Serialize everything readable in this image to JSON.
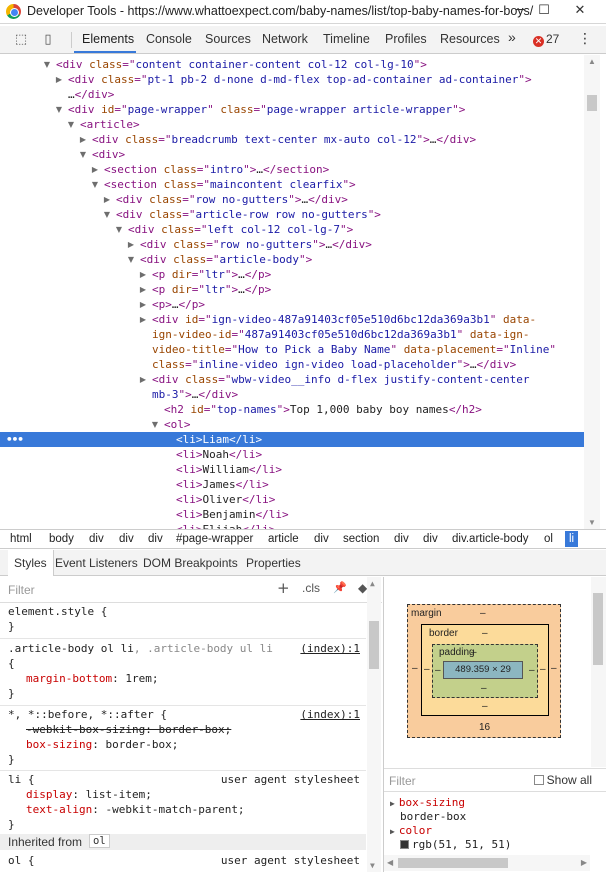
{
  "window": {
    "title": "Developer Tools - https://www.whattoexpect.com/baby-names/list/top-baby-names-for-boys/",
    "minimize_glyph": "─",
    "maximize_glyph": "☐",
    "close_glyph": "✕"
  },
  "toolbar": {
    "inspect_icon": "⬚",
    "device_icon": "▯",
    "tabs": [
      "Elements",
      "Console",
      "Sources",
      "Network",
      "Timeline",
      "Profiles",
      "Resources"
    ],
    "more_glyph": "»",
    "error_count": "27",
    "error_glyph": "✕",
    "menu_glyph": "⋮"
  },
  "dom_rows": [
    {
      "arrow": "▼",
      "indent": 56,
      "parts": [
        [
          "tag",
          "<div "
        ],
        [
          "attr",
          "class"
        ],
        [
          "tag",
          "=\""
        ],
        [
          "val",
          "content container-content col-12 col-lg-10"
        ],
        [
          "tag",
          "\">"
        ]
      ]
    },
    {
      "arrow": "▶",
      "indent": 68,
      "parts": [
        [
          "tag",
          "<div "
        ],
        [
          "attr",
          "class"
        ],
        [
          "tag",
          "=\""
        ],
        [
          "val",
          "pt-1 pb-2 d-none d-md-flex top-ad-container ad-container"
        ],
        [
          "tag",
          "\">"
        ]
      ]
    },
    {
      "arrow": "",
      "indent": 68,
      "parts": [
        [
          "txt",
          "…"
        ],
        [
          "tag",
          "</div>"
        ]
      ]
    },
    {
      "arrow": "▼",
      "indent": 68,
      "parts": [
        [
          "tag",
          "<div "
        ],
        [
          "attr",
          "id"
        ],
        [
          "tag",
          "=\""
        ],
        [
          "val",
          "page-wrapper"
        ],
        [
          "tag",
          "\" "
        ],
        [
          "attr",
          "class"
        ],
        [
          "tag",
          "=\""
        ],
        [
          "val",
          "page-wrapper article-wrapper"
        ],
        [
          "tag",
          "\">"
        ]
      ]
    },
    {
      "arrow": "▼",
      "indent": 80,
      "parts": [
        [
          "tag",
          "<article>"
        ]
      ]
    },
    {
      "arrow": "▶",
      "indent": 92,
      "parts": [
        [
          "tag",
          "<div "
        ],
        [
          "attr",
          "class"
        ],
        [
          "tag",
          "=\""
        ],
        [
          "val",
          "breadcrumb text-center mx-auto col-12"
        ],
        [
          "tag",
          "\">"
        ],
        [
          "txt",
          "…"
        ],
        [
          "tag",
          "</div>"
        ]
      ]
    },
    {
      "arrow": "▼",
      "indent": 92,
      "parts": [
        [
          "tag",
          "<div>"
        ]
      ]
    },
    {
      "arrow": "▶",
      "indent": 104,
      "parts": [
        [
          "tag",
          "<section "
        ],
        [
          "attr",
          "class"
        ],
        [
          "tag",
          "=\""
        ],
        [
          "val",
          "intro"
        ],
        [
          "tag",
          "\">"
        ],
        [
          "txt",
          "…"
        ],
        [
          "tag",
          "</section>"
        ]
      ]
    },
    {
      "arrow": "▼",
      "indent": 104,
      "parts": [
        [
          "tag",
          "<section "
        ],
        [
          "attr",
          "class"
        ],
        [
          "tag",
          "=\""
        ],
        [
          "val",
          "maincontent clearfix"
        ],
        [
          "tag",
          "\">"
        ]
      ]
    },
    {
      "arrow": "▶",
      "indent": 116,
      "parts": [
        [
          "tag",
          "<div "
        ],
        [
          "attr",
          "class"
        ],
        [
          "tag",
          "=\""
        ],
        [
          "val",
          "row no-gutters"
        ],
        [
          "tag",
          "\">"
        ],
        [
          "txt",
          "…"
        ],
        [
          "tag",
          "</div>"
        ]
      ]
    },
    {
      "arrow": "▼",
      "indent": 116,
      "parts": [
        [
          "tag",
          "<div "
        ],
        [
          "attr",
          "class"
        ],
        [
          "tag",
          "=\""
        ],
        [
          "val",
          "article-row row no-gutters"
        ],
        [
          "tag",
          "\">"
        ]
      ]
    },
    {
      "arrow": "▼",
      "indent": 128,
      "parts": [
        [
          "tag",
          "<div "
        ],
        [
          "attr",
          "class"
        ],
        [
          "tag",
          "=\""
        ],
        [
          "val",
          "left col-12 col-lg-7"
        ],
        [
          "tag",
          "\">"
        ]
      ]
    },
    {
      "arrow": "▶",
      "indent": 140,
      "parts": [
        [
          "tag",
          "<div "
        ],
        [
          "attr",
          "class"
        ],
        [
          "tag",
          "=\""
        ],
        [
          "val",
          "row no-gutters"
        ],
        [
          "tag",
          "\">"
        ],
        [
          "txt",
          "…"
        ],
        [
          "tag",
          "</div>"
        ]
      ]
    },
    {
      "arrow": "▼",
      "indent": 140,
      "parts": [
        [
          "tag",
          "<div "
        ],
        [
          "attr",
          "class"
        ],
        [
          "tag",
          "=\""
        ],
        [
          "val",
          "article-body"
        ],
        [
          "tag",
          "\">"
        ]
      ]
    },
    {
      "arrow": "▶",
      "indent": 152,
      "parts": [
        [
          "tag",
          "<p "
        ],
        [
          "attr",
          "dir"
        ],
        [
          "tag",
          "=\""
        ],
        [
          "val",
          "ltr"
        ],
        [
          "tag",
          "\">"
        ],
        [
          "txt",
          "…"
        ],
        [
          "tag",
          "</p>"
        ]
      ]
    },
    {
      "arrow": "▶",
      "indent": 152,
      "parts": [
        [
          "tag",
          "<p "
        ],
        [
          "attr",
          "dir"
        ],
        [
          "tag",
          "=\""
        ],
        [
          "val",
          "ltr"
        ],
        [
          "tag",
          "\">"
        ],
        [
          "txt",
          "…"
        ],
        [
          "tag",
          "</p>"
        ]
      ]
    },
    {
      "arrow": "▶",
      "indent": 152,
      "parts": [
        [
          "tag",
          "<p>"
        ],
        [
          "txt",
          "…"
        ],
        [
          "tag",
          "</p>"
        ]
      ]
    },
    {
      "arrow": "▶",
      "indent": 152,
      "parts": [
        [
          "tag",
          "<div "
        ],
        [
          "attr",
          "id"
        ],
        [
          "tag",
          "=\""
        ],
        [
          "val",
          "ign-video-487a91403cf05e510d6bc12da369a3b1"
        ],
        [
          "tag",
          "\" "
        ],
        [
          "attr",
          "data-"
        ]
      ]
    },
    {
      "arrow": "",
      "indent": 152,
      "parts": [
        [
          "attr",
          "ign-video-id"
        ],
        [
          "tag",
          "=\""
        ],
        [
          "val",
          "487a91403cf05e510d6bc12da369a3b1"
        ],
        [
          "tag",
          "\" "
        ],
        [
          "attr",
          "data-ign-"
        ]
      ]
    },
    {
      "arrow": "",
      "indent": 152,
      "parts": [
        [
          "attr",
          "video-title"
        ],
        [
          "tag",
          "=\""
        ],
        [
          "val",
          "How to Pick a Baby Name"
        ],
        [
          "tag",
          "\" "
        ],
        [
          "attr",
          "data-placement"
        ],
        [
          "tag",
          "=\""
        ],
        [
          "val",
          "Inline"
        ],
        [
          "tag",
          "\""
        ]
      ]
    },
    {
      "arrow": "",
      "indent": 152,
      "parts": [
        [
          "attr",
          "class"
        ],
        [
          "tag",
          "=\""
        ],
        [
          "val",
          "inline-video ign-video load-placeholder"
        ],
        [
          "tag",
          "\">"
        ],
        [
          "txt",
          "…"
        ],
        [
          "tag",
          "</div>"
        ]
      ]
    },
    {
      "arrow": "▶",
      "indent": 152,
      "parts": [
        [
          "tag",
          "<div "
        ],
        [
          "attr",
          "class"
        ],
        [
          "tag",
          "=\""
        ],
        [
          "val",
          "wbw-video__info d-flex justify-content-center"
        ]
      ]
    },
    {
      "arrow": "",
      "indent": 152,
      "parts": [
        [
          "val",
          "mb-3"
        ],
        [
          "tag",
          "\">"
        ],
        [
          "txt",
          "…"
        ],
        [
          "tag",
          "</div>"
        ]
      ]
    },
    {
      "arrow": "",
      "indent": 164,
      "parts": [
        [
          "tag",
          "<h2 "
        ],
        [
          "attr",
          "id"
        ],
        [
          "tag",
          "=\""
        ],
        [
          "val",
          "top-names"
        ],
        [
          "tag",
          "\">"
        ],
        [
          "txt",
          "Top 1,000 baby boy names"
        ],
        [
          "tag",
          "</h2>"
        ]
      ]
    },
    {
      "arrow": "▼",
      "indent": 164,
      "parts": [
        [
          "tag",
          "<ol>"
        ]
      ]
    },
    {
      "arrow": "",
      "indent": 176,
      "selected": true,
      "parts": [
        [
          "tag",
          "<li>"
        ],
        [
          "txt",
          "Liam"
        ],
        [
          "tag",
          "</li>"
        ]
      ]
    },
    {
      "arrow": "",
      "indent": 176,
      "parts": [
        [
          "tag",
          "<li>"
        ],
        [
          "txt",
          "Noah"
        ],
        [
          "tag",
          "</li>"
        ]
      ]
    },
    {
      "arrow": "",
      "indent": 176,
      "parts": [
        [
          "tag",
          "<li>"
        ],
        [
          "txt",
          "William"
        ],
        [
          "tag",
          "</li>"
        ]
      ]
    },
    {
      "arrow": "",
      "indent": 176,
      "parts": [
        [
          "tag",
          "<li>"
        ],
        [
          "txt",
          "James"
        ],
        [
          "tag",
          "</li>"
        ]
      ]
    },
    {
      "arrow": "",
      "indent": 176,
      "parts": [
        [
          "tag",
          "<li>"
        ],
        [
          "txt",
          "Oliver"
        ],
        [
          "tag",
          "</li>"
        ]
      ]
    },
    {
      "arrow": "",
      "indent": 176,
      "parts": [
        [
          "tag",
          "<li>"
        ],
        [
          "txt",
          "Benjamin"
        ],
        [
          "tag",
          "</li>"
        ]
      ]
    },
    {
      "arrow": "",
      "indent": 176,
      "parts": [
        [
          "tag",
          "<li>"
        ],
        [
          "txt",
          "Elijah"
        ],
        [
          "tag",
          "</li>"
        ]
      ]
    }
  ],
  "selected_marker": "•••",
  "breadcrumbs": [
    "html",
    "body",
    "div",
    "div",
    "div",
    "#page-wrapper",
    "article",
    "div",
    "section",
    "div",
    "div",
    "div.article-body",
    "ol",
    "li"
  ],
  "subtabs": [
    "Styles",
    "Event Listeners",
    "DOM Breakpoints",
    "Properties"
  ],
  "styles": {
    "filter_placeholder": "Filter",
    "add_glyph": "+",
    "cls_label": ".cls",
    "pin_glyph": "📌",
    "arrow_glyph": "◆",
    "element_style": "element.style {",
    "close_brace": "}",
    "rule1_selector": ".article-body ol li",
    "rule1_selector_dim": ", .article-body ul li",
    "rule1_source": "(index):1",
    "rule1_prop": "margin-bottom",
    "rule1_val": "1rem;",
    "open_brace": "{",
    "rule2_selector": "*, *::before, *::after {",
    "rule2_source": "(index):1",
    "rule2_prop1": "-webkit-box-sizing: border-box;",
    "rule2_prop2": "box-sizing",
    "rule2_val2": "border-box;",
    "rule3_selector": "li {",
    "rule3_source": "user agent stylesheet",
    "rule3_prop1": "display",
    "rule3_val1": "list-item;",
    "rule3_prop2": "text-align",
    "rule3_val2": "-webkit-match-parent;",
    "inherited_label": "Inherited from",
    "inherited_tag": "ol",
    "rule4_selector": "ol {",
    "rule4_source": "user agent stylesheet"
  },
  "box_model": {
    "margin_label": "margin",
    "border_label": "border",
    "padding_label": "padding",
    "dash": "–",
    "content_size": "489.359 × 29",
    "margin_bottom": "16"
  },
  "computed": {
    "filter_placeholder": "Filter",
    "show_all": "Show all",
    "prop1_name": "box-sizing",
    "prop1_value": "border-box",
    "prop2_name": "color",
    "prop2_value": "rgb(51, 51, 51)",
    "expand_glyph": "▶"
  },
  "colors": {
    "selection": "#3879d9",
    "tag": "#881280",
    "attr": "#994500",
    "value": "#1a1aa6",
    "css_prop": "#c80000"
  }
}
